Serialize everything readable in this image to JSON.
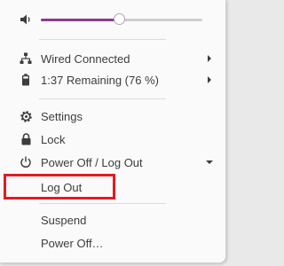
{
  "volume": {
    "level_percent": 49,
    "icon": "speaker-icon"
  },
  "network": {
    "label": "Wired Connected",
    "icon": "wired-network-icon"
  },
  "battery": {
    "label": "1:37 Remaining (76 %)",
    "icon": "battery-icon"
  },
  "actions": {
    "settings_label": "Settings",
    "lock_label": "Lock",
    "power_label": "Power Off / Log Out"
  },
  "power_submenu": {
    "logout_label": "Log Out",
    "suspend_label": "Suspend",
    "poweroff_label": "Power Off…"
  },
  "colors": {
    "accent": "#8c3a8c",
    "highlight": "#e21b23"
  }
}
